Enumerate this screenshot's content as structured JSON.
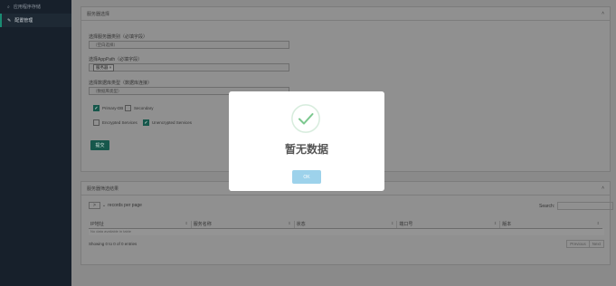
{
  "sidebar": {
    "items": [
      {
        "icon": "search-icon",
        "label": "应用程序存储"
      },
      {
        "icon": "wrench-icon",
        "label": "配置管理"
      }
    ]
  },
  "form_panel": {
    "title": "服务器选择",
    "field1_label": "选择服务器类别（必填字段）",
    "field1_value": "（空白选择）",
    "field2_label": "选择AppPath（必填字段）",
    "field2_tag": "服务器 ×",
    "field3_label": "选择数据库类型（数据库连接）",
    "field3_value": "（数据库类型）",
    "check_primary": "Primary-DB",
    "check_secondary": "Secondary",
    "check_encrypted": "Encrypted Services",
    "check_unencrypted": "Unencrypted Services",
    "submit_label": "提交"
  },
  "table_panel": {
    "title": "服务器筛选结果",
    "records_per_page": "records per page",
    "page_size": ">",
    "search_label": "Search:",
    "columns": [
      "IP地址",
      "服务名称",
      "状态",
      "端口号",
      "版本"
    ],
    "empty_text": "No data available in table",
    "info": "Showing 0 to 0 of 0 entries",
    "prev": "Previous",
    "next": "Next"
  },
  "modal": {
    "title": "暂无数据",
    "ok_label": "OK"
  },
  "colors": {
    "sidebar_bg": "#17202b",
    "accent": "#16574b",
    "ok_button": "#9dd2eb",
    "check_green": "#7cc88f"
  }
}
